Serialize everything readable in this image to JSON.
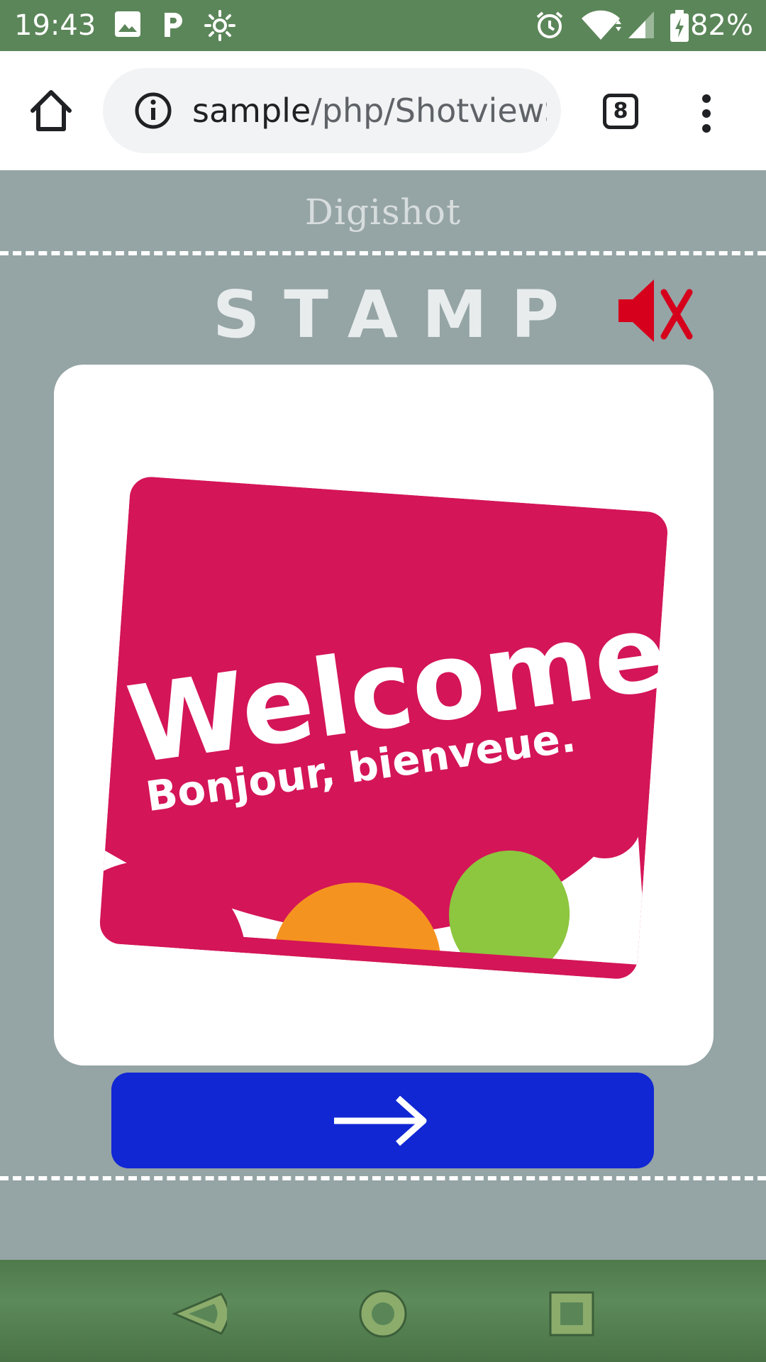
{
  "status_bar": {
    "time": "19:43",
    "battery_percent": "82%",
    "icons": [
      "image-icon",
      "parking-icon",
      "brightness-icon",
      "alarm-icon",
      "wifi-icon",
      "signal-icon",
      "battery-charging-icon"
    ]
  },
  "browser": {
    "url_host": "sample",
    "url_path": "/php/ShotviewS",
    "tab_count": "8",
    "icons": [
      "home-icon",
      "info-icon",
      "more-vert-icon"
    ]
  },
  "page": {
    "brand": "Digishot",
    "title": "STAMP",
    "mute_icon": "speaker-muted-icon",
    "stamp": {
      "headline": "Welcome",
      "subline": "Bonjour, bienveue.",
      "colors": {
        "card": "#d41558",
        "orange": "#f59320",
        "green": "#8dc63f"
      }
    },
    "next_button_icon": "arrow-right-icon",
    "colors": {
      "background": "#95a4a5",
      "button": "#1027d3",
      "mute": "#d6001c"
    }
  },
  "nav_bar": {
    "icons": [
      "back-icon",
      "home-circle-icon",
      "recents-icon"
    ]
  }
}
